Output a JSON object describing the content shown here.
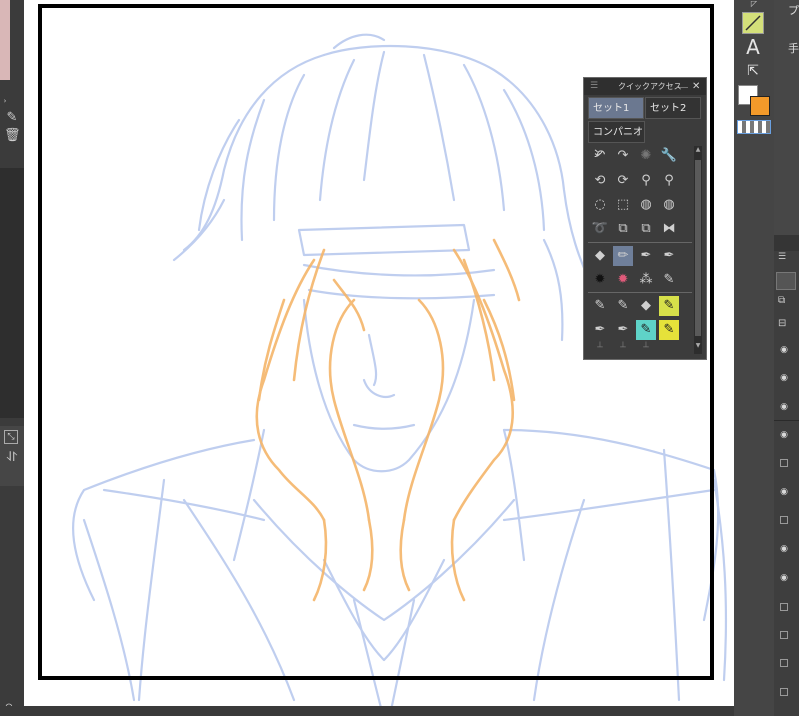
{
  "quick_access": {
    "title": "クイックアクセス",
    "tabs": [
      {
        "label": "セット1",
        "selected": true
      },
      {
        "label": "セット2",
        "selected": false
      }
    ],
    "companion_label": "コンパニオン",
    "minimize_glyph": "＿",
    "close_glyph": "✕"
  },
  "right_toolbar": {
    "text_tool_glyph": "A",
    "main_color": "#ffffff",
    "sub_color": "#f39a2a"
  },
  "right_panel": {
    "top_label_1": "プ",
    "top_label_2": "手"
  },
  "sketch": {
    "rough_color": "#b9c9ee",
    "hands_color": "#f5b56a"
  }
}
